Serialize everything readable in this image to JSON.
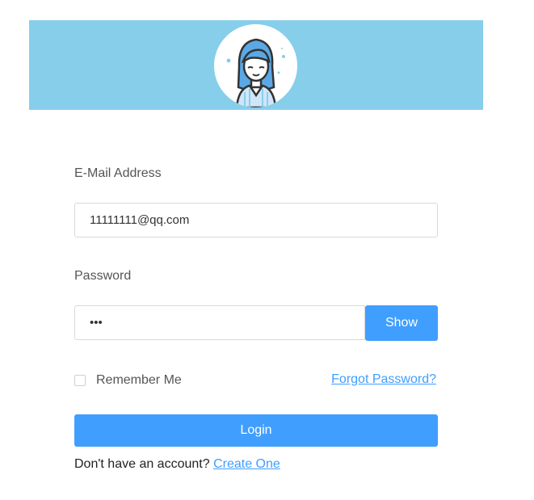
{
  "login_form": {
    "email": {
      "label": "E-Mail Address",
      "value": "11111111@qq.com"
    },
    "password": {
      "label": "Password",
      "value": "abc",
      "show_label": "Show"
    },
    "remember_me_label": "Remember Me",
    "remember_me_checked": false,
    "forgot_password_label": "Forgot Password?",
    "login_label": "Login",
    "signup_prompt": "Don't have an account?",
    "create_account_label": "Create One"
  },
  "colors": {
    "banner": "#87ceeb",
    "accent": "#409eff"
  },
  "avatar": {
    "icon": "user-avatar-icon"
  }
}
